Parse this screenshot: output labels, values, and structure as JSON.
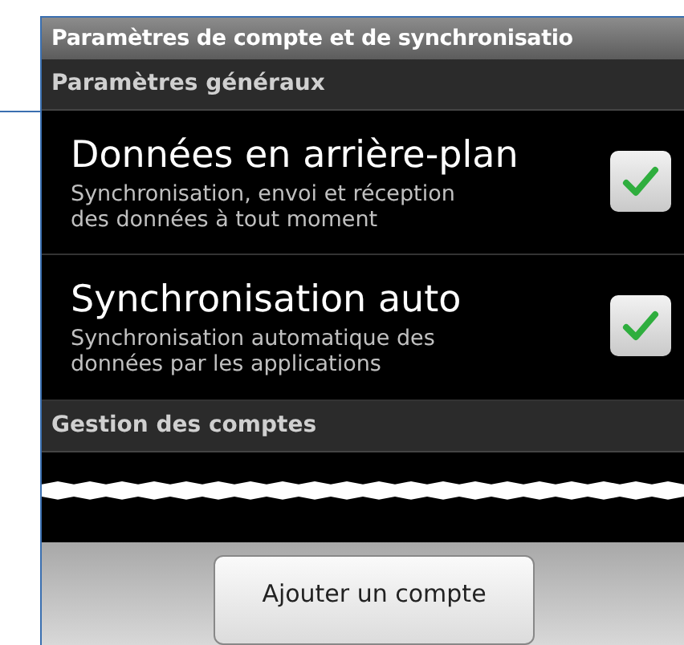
{
  "title": "Paramètres de compte et de synchronisatio",
  "sections": [
    {
      "header": "Paramètres généraux",
      "items": [
        {
          "title": "Données en arrière-plan",
          "summary": "Synchronisation, envoi et réception des données à tout moment",
          "checked": true
        },
        {
          "title": "Synchronisation auto",
          "summary": "Synchronisation automatique des données par les applications",
          "checked": true
        }
      ]
    },
    {
      "header": "Gestion des comptes"
    }
  ],
  "button": "Ajouter un compte"
}
